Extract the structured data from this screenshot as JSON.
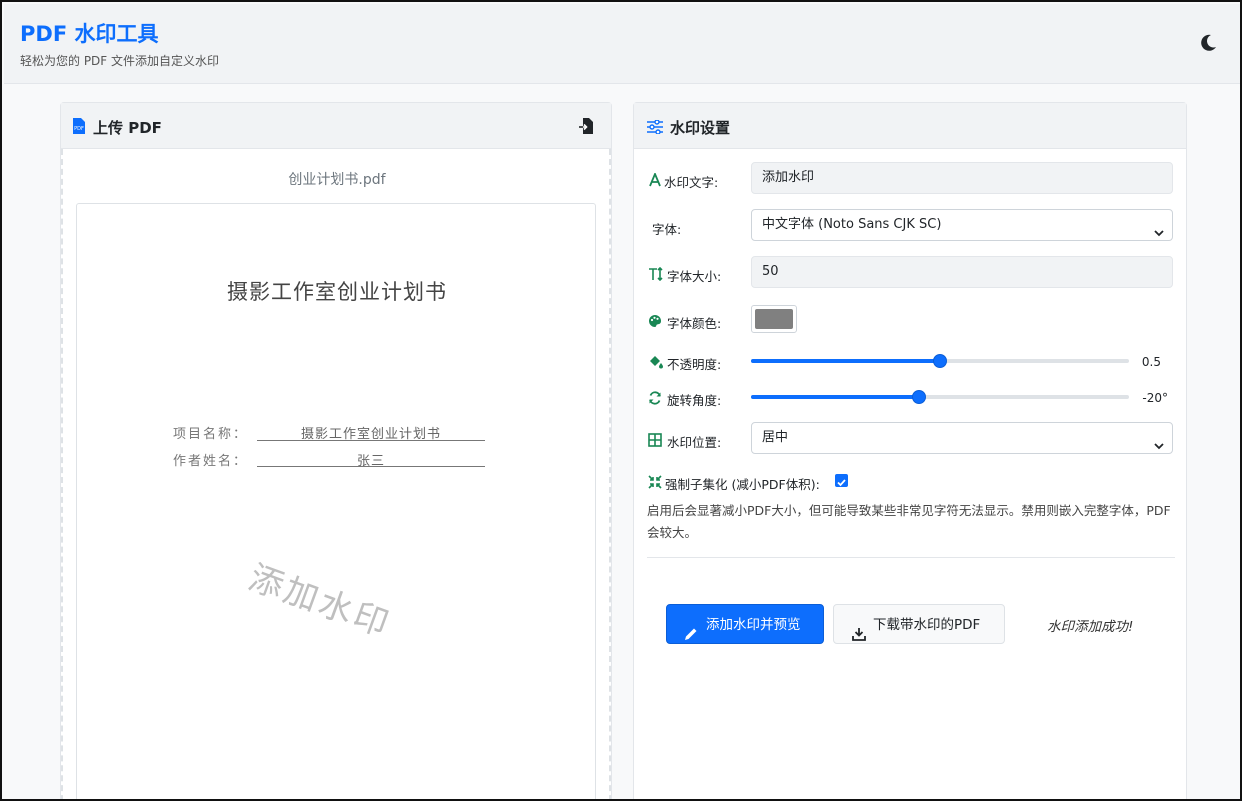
{
  "app": {
    "title": "PDF 水印工具",
    "subtitle": "轻松为您的 PDF 文件添加自定义水印",
    "theme_icon": "moon-icon"
  },
  "upload": {
    "header": "上传 PDF",
    "file_name": "创业计划书.pdf"
  },
  "preview": {
    "doc_title": "摄影工作室创业计划书",
    "project_label": "项目名称：",
    "project_value": "摄影工作室创业计划书",
    "author_label": "作者姓名：",
    "author_value": "张三",
    "watermark_text": "添加水印"
  },
  "settings": {
    "header": "水印设置",
    "text_label": "水印文字:",
    "text_value": "添加水印",
    "font_label": "字体:",
    "font_value": "中文字体 (Noto Sans CJK SC)",
    "size_label": "字体大小:",
    "size_value": "50",
    "color_label": "字体颜色:",
    "color_value": "#808080",
    "opacity_label": "不透明度:",
    "opacity_value": "0.5",
    "opacity_fraction": 0.5,
    "rotation_label": "旋转角度:",
    "rotation_value": "-20°",
    "rotation_fraction": 0.444,
    "position_label": "水印位置:",
    "position_value": "居中",
    "subset_label": "强制子集化 (减小PDF体积):",
    "subset_checked": true,
    "help_text": "启用后会显著减小PDF大小，但可能导致某些非常见字符无法显示。禁用则嵌入完整字体，PDF会较大。"
  },
  "actions": {
    "preview_button": "添加水印并预览",
    "download_button": "下载带水印的PDF",
    "status": "水印添加成功!"
  },
  "colors": {
    "primary": "#0d6efd",
    "icon_green": "#198754"
  }
}
